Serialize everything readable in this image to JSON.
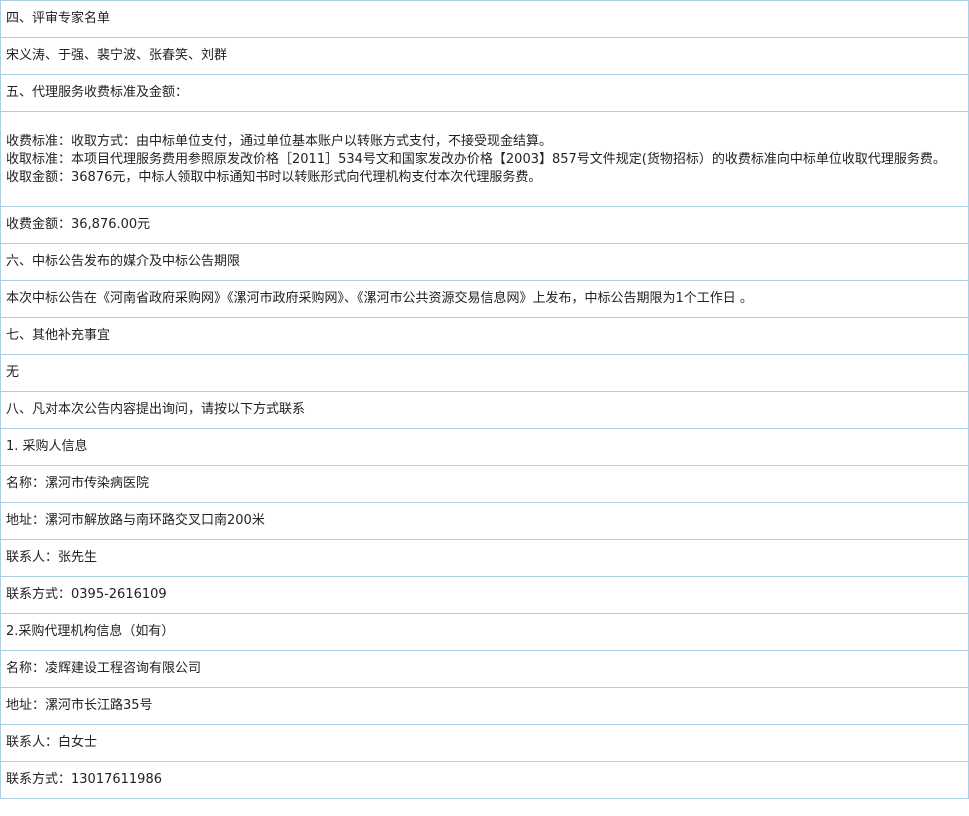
{
  "rows": [
    {
      "id": "review-experts-heading",
      "lines": [
        "四、评审专家名单"
      ]
    },
    {
      "id": "review-experts-list",
      "lines": [
        "宋义涛、于强、裴宁波、张春笑、刘群"
      ]
    },
    {
      "id": "agency-fee-heading",
      "lines": [
        "五、代理服务收费标准及金额："
      ]
    },
    {
      "id": "agency-fee-details",
      "lines": [
        "收费标准：收取方式：由中标单位支付，通过单位基本账户以转账方式支付，不接受现金结算。",
        "收取标准：本项目代理服务费用参照原发改价格［2011］534号文和国家发改办价格【2003】857号文件规定(货物招标）的收费标准向中标单位收取代理服务费。",
        "收取金额：36876元，中标人领取中标通知书时以转账形式向代理机构支付本次代理服务费。"
      ]
    },
    {
      "id": "fee-amount",
      "lines": [
        "收费金额：36,876.00元"
      ]
    },
    {
      "id": "media-period-heading",
      "lines": [
        "六、中标公告发布的媒介及中标公告期限"
      ]
    },
    {
      "id": "media-period-text",
      "lines": [
        "本次中标公告在《河南省政府采购网》《漯河市政府采购网》、《漯河市公共资源交易信息网》上发布，中标公告期限为1个工作日 。"
      ]
    },
    {
      "id": "other-matters-heading",
      "lines": [
        "七、其他补充事宜"
      ]
    },
    {
      "id": "other-matters-text",
      "lines": [
        "无"
      ]
    },
    {
      "id": "contact-heading",
      "lines": [
        "八、凡对本次公告内容提出询问，请按以下方式联系"
      ]
    },
    {
      "id": "purchaser-heading",
      "lines": [
        "1. 采购人信息"
      ]
    },
    {
      "id": "purchaser-name",
      "lines": [
        "名称：漯河市传染病医院"
      ]
    },
    {
      "id": "purchaser-address",
      "lines": [
        "地址：漯河市解放路与南环路交叉口南200米"
      ]
    },
    {
      "id": "purchaser-contact-person",
      "lines": [
        "联系人：张先生"
      ]
    },
    {
      "id": "purchaser-phone",
      "lines": [
        "联系方式：0395-2616109"
      ]
    },
    {
      "id": "agency-heading",
      "lines": [
        "2.采购代理机构信息（如有）"
      ]
    },
    {
      "id": "agency-name",
      "lines": [
        "名称：凌辉建设工程咨询有限公司"
      ]
    },
    {
      "id": "agency-address",
      "lines": [
        "地址：漯河市长江路35号"
      ]
    },
    {
      "id": "agency-contact-person",
      "lines": [
        "联系人：白女士"
      ]
    },
    {
      "id": "agency-phone",
      "lines": [
        "联系方式：13017611986"
      ]
    }
  ]
}
